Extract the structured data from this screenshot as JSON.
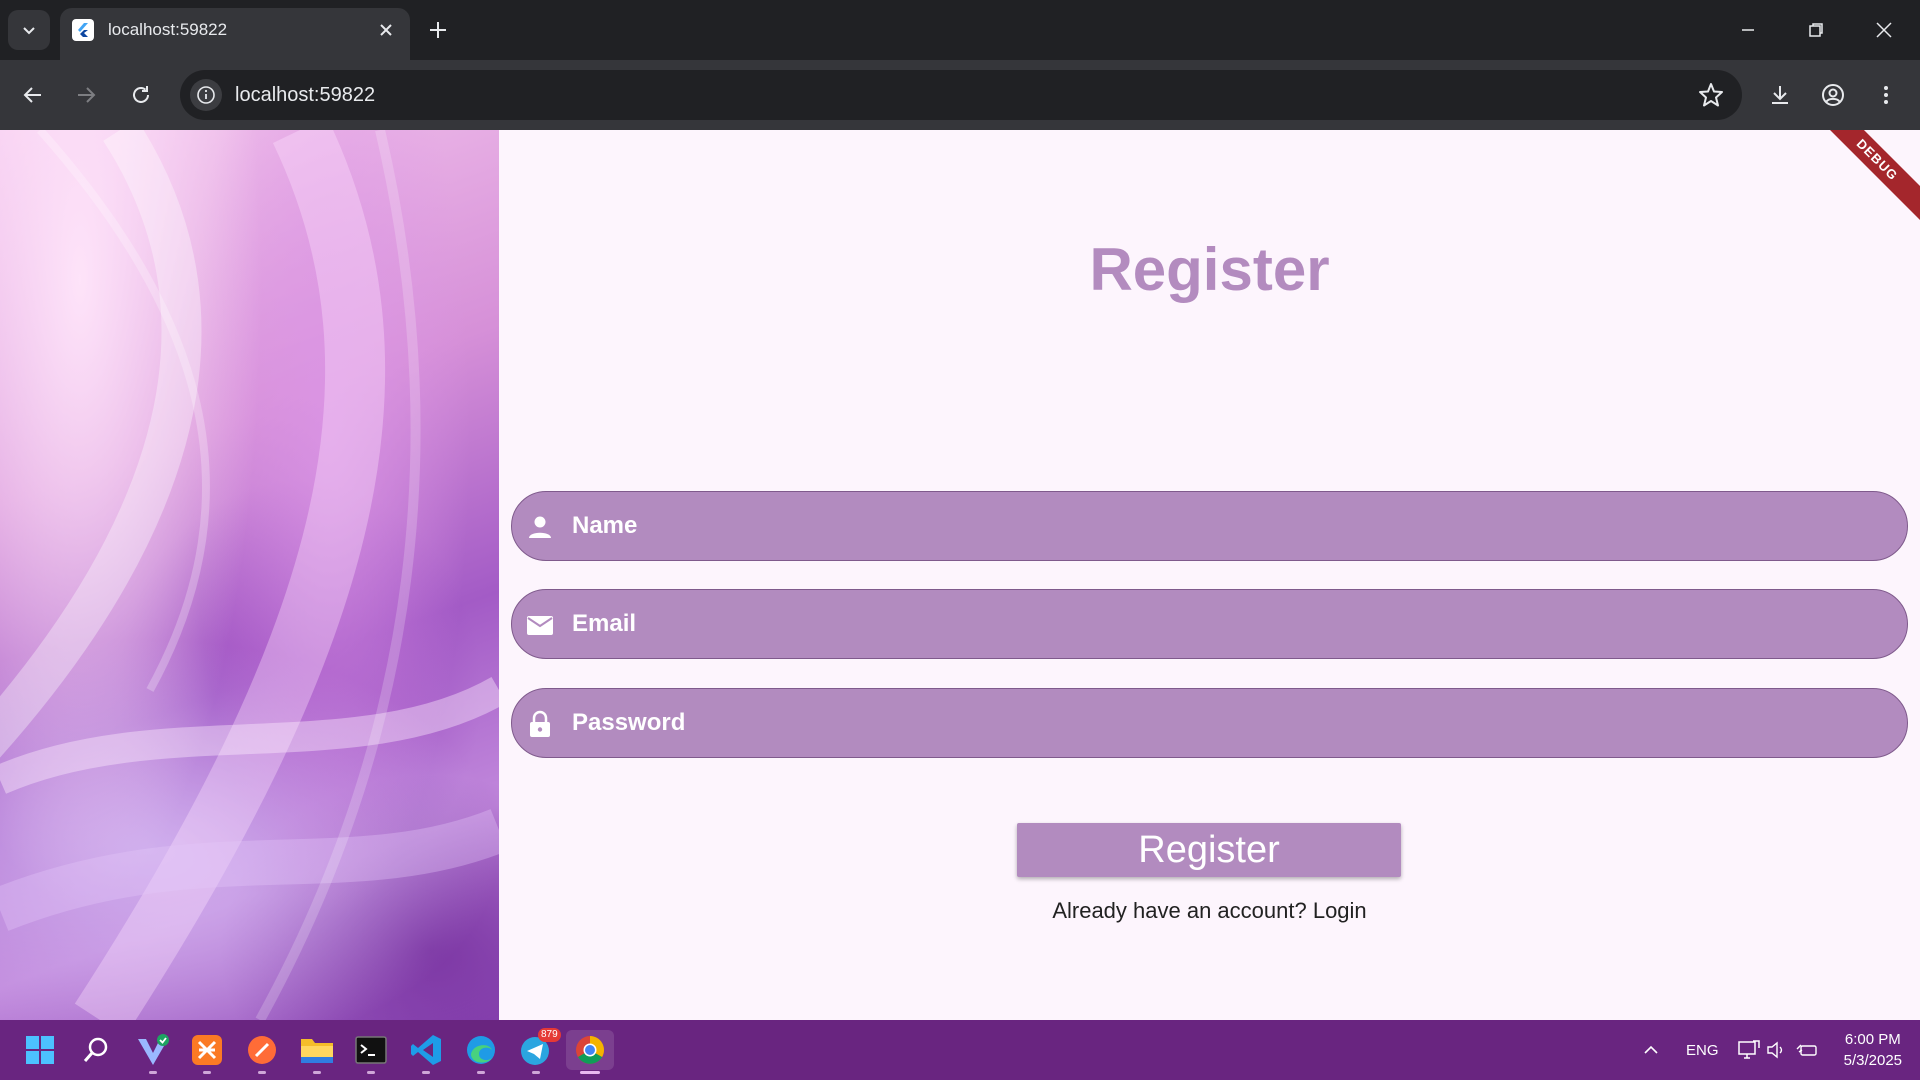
{
  "browser": {
    "tab_title": "localhost:59822",
    "url": "localhost:59822"
  },
  "page": {
    "debug_banner": "DEBUG",
    "title": "Register",
    "fields": [
      {
        "label": "Name",
        "icon": "person-icon"
      },
      {
        "label": "Email",
        "icon": "mail-icon"
      },
      {
        "label": "Password",
        "icon": "lock-icon"
      }
    ],
    "register_button": "Register",
    "login_prompt": "Already have an account? Login"
  },
  "taskbar": {
    "apps": [
      "start-icon",
      "search-icon",
      "vector-app-icon",
      "xampp-icon",
      "postman-icon",
      "file-explorer-icon",
      "terminal-icon",
      "vscode-icon",
      "edge-icon",
      "telegram-icon",
      "chrome-icon"
    ],
    "telegram_badge": "879",
    "language": "ENG",
    "time": "6:00 PM",
    "date": "5/3/2025"
  },
  "colors": {
    "accent": "#b28bbf",
    "title": "#b38bbf",
    "taskbar": "#692580",
    "page_bg": "#fdf5fd"
  }
}
